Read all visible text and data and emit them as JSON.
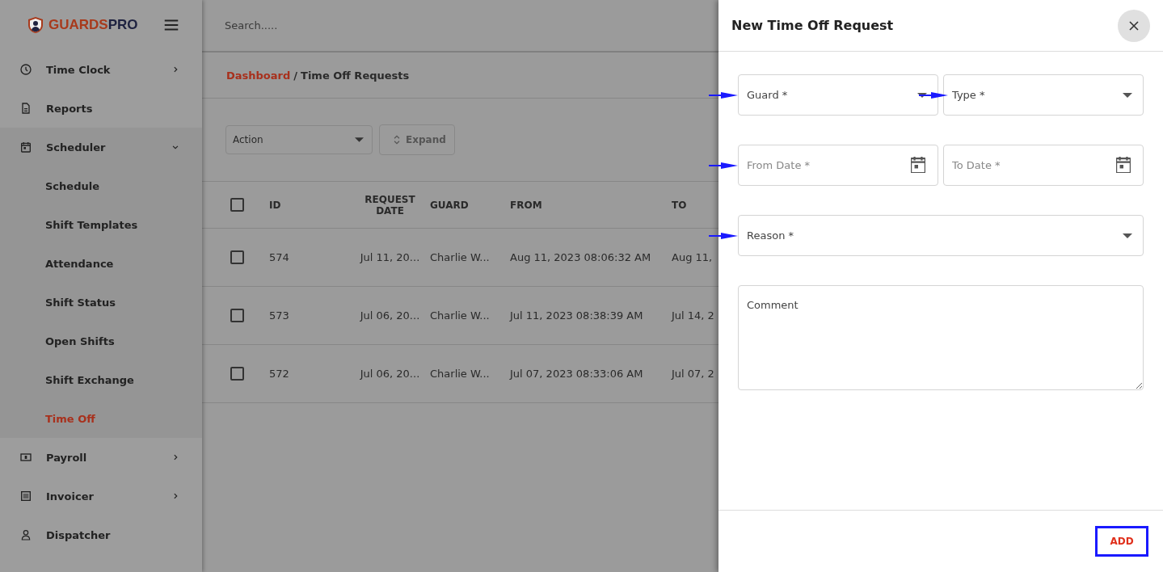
{
  "brand": {
    "name_first": "GUARDS",
    "name_second": "PRO"
  },
  "sidebar": {
    "items": [
      {
        "label": "Time Clock",
        "has_arrow": true,
        "expanded": false,
        "selected": false
      },
      {
        "label": "Reports",
        "has_arrow": false,
        "selected": false
      },
      {
        "label": "Scheduler",
        "has_arrow": true,
        "expanded": true,
        "selected": false,
        "children": [
          {
            "label": "Schedule",
            "selected": false
          },
          {
            "label": "Shift Templates",
            "selected": false
          },
          {
            "label": "Attendance",
            "selected": false
          },
          {
            "label": "Shift Status",
            "selected": false
          },
          {
            "label": "Open Shifts",
            "selected": false
          },
          {
            "label": "Shift Exchange",
            "selected": false
          },
          {
            "label": "Time Off",
            "selected": true
          }
        ]
      },
      {
        "label": "Payroll",
        "has_arrow": true,
        "expanded": false,
        "selected": false
      },
      {
        "label": "Invoicer",
        "has_arrow": true,
        "expanded": false,
        "selected": false
      },
      {
        "label": "Dispatcher",
        "has_arrow": false,
        "selected": false
      }
    ]
  },
  "search": {
    "placeholder": "Search....."
  },
  "breadcrumb": {
    "link": "Dashboard",
    "separator": "/",
    "current": "Time Off Requests"
  },
  "toolbar": {
    "action_placeholder": "Action",
    "expand_label": "Expand"
  },
  "table": {
    "all_checked": false,
    "columns": [
      "ID",
      "REQUEST DATE",
      "GUARD",
      "FROM",
      "TO"
    ],
    "rows": [
      {
        "checked": false,
        "cells": [
          "574",
          "Jul 11, 20...",
          "Charlie W...",
          "Aug 11, 2023 08:06:32 AM",
          "Aug 11,"
        ]
      },
      {
        "checked": false,
        "cells": [
          "573",
          "Jul 06, 20...",
          "Charlie W...",
          "Jul 11, 2023 08:38:39 AM",
          "Jul 14, 2"
        ]
      },
      {
        "checked": false,
        "cells": [
          "572",
          "Jul 06, 20...",
          "Charlie W...",
          "Jul 07, 2023 08:33:06 AM",
          "Jul 07, 2"
        ]
      }
    ]
  },
  "drawer": {
    "title": "New Time Off Request",
    "fields": [
      {
        "kind": "select",
        "label": "Guard *",
        "annotated": true
      },
      {
        "kind": "select",
        "label": "Type *",
        "annotated": true
      },
      {
        "kind": "date",
        "placeholder": "From Date *",
        "annotated": true
      },
      {
        "kind": "date",
        "placeholder": "To Date *",
        "annotated": false
      },
      {
        "kind": "select",
        "label": "Reason *",
        "annotated": true
      },
      {
        "kind": "textarea",
        "placeholder": "Comment",
        "annotated": false
      }
    ],
    "add_button": "ADD"
  }
}
